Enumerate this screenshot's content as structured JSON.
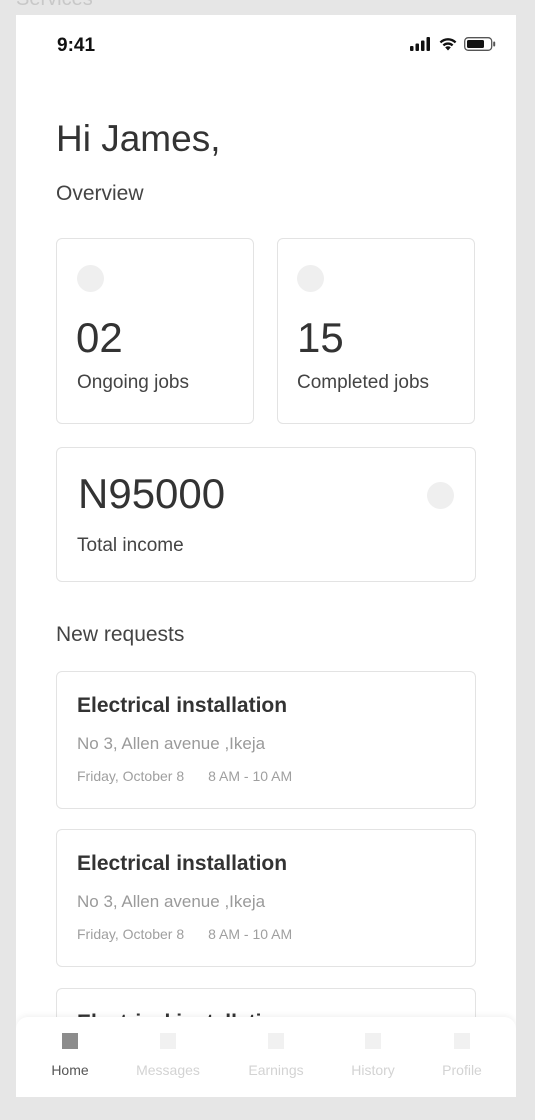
{
  "frame": {
    "label": "Services"
  },
  "status_bar": {
    "time": "9:41",
    "icons": [
      "cellular-signal-icon",
      "wifi-icon",
      "battery-icon"
    ]
  },
  "header": {
    "greeting": "Hi James,",
    "overview_label": "Overview"
  },
  "stats": {
    "ongoing": {
      "value": "02",
      "label": "Ongoing jobs"
    },
    "completed": {
      "value": "15",
      "label": "Completed jobs"
    },
    "income": {
      "value": "N95000",
      "label": "Total income"
    }
  },
  "requests": {
    "title": "New requests",
    "items": [
      {
        "title": "Electrical installation",
        "address": "No 3, Allen avenue ,Ikeja",
        "date": "Friday, October 8",
        "time": "8 AM - 10  AM"
      },
      {
        "title": "Electrical installation",
        "address": "No 3, Allen avenue ,Ikeja",
        "date": "Friday, October 8",
        "time": "8 AM - 10  AM"
      },
      {
        "title": "Electrical installation"
      }
    ]
  },
  "tabbar": {
    "items": [
      {
        "label": "Home",
        "active": true
      },
      {
        "label": "Messages",
        "active": false
      },
      {
        "label": "Earnings",
        "active": false
      },
      {
        "label": "History",
        "active": false
      },
      {
        "label": "Profile",
        "active": false
      }
    ]
  },
  "colors": {
    "background": "#e6e6e6",
    "card_border": "#e3e3e3",
    "text": "#333333",
    "muted": "#9a9a9a"
  }
}
